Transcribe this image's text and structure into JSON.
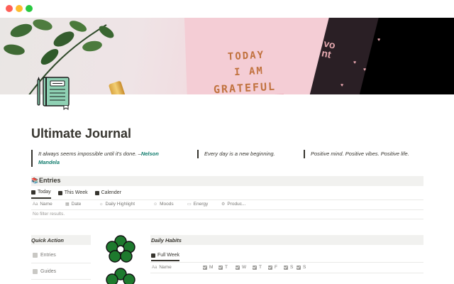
{
  "window": {
    "controls": [
      "close",
      "minimize",
      "maximize"
    ]
  },
  "cover": {
    "notebook_lines": [
      "TODAY",
      "I AM",
      "GRATEFUL"
    ],
    "corner_text": "vo\nnt"
  },
  "page": {
    "icon": "notebook-icon",
    "title": "Ultimate Journal"
  },
  "quotes": [
    {
      "text": "It always seems impossible until it's done. –",
      "author": "Nelson Mandela"
    },
    {
      "text": "Every day is a new beginning.",
      "author": ""
    },
    {
      "text": "Positive mind. Positive vibes. Positive life.",
      "author": ""
    }
  ],
  "entries": {
    "icon": "books-icon",
    "title": "Entries",
    "tabs": [
      {
        "label": "Today",
        "icon": "table-icon",
        "active": true
      },
      {
        "label": "This Week",
        "icon": "table-icon",
        "active": false
      },
      {
        "label": "Calender",
        "icon": "table-icon",
        "active": false
      }
    ],
    "properties": [
      {
        "label": "Name",
        "icon": "text-icon"
      },
      {
        "label": "Date",
        "icon": "calendar-icon"
      },
      {
        "label": "Daily Highlight",
        "icon": "sun-icon"
      },
      {
        "label": "Moods",
        "icon": "smiley-icon"
      },
      {
        "label": "Energy",
        "icon": "battery-icon"
      },
      {
        "label": "Produc...",
        "icon": "gear-icon"
      }
    ],
    "empty_text": "No filter results."
  },
  "quick_action": {
    "title": "Quick Action",
    "items": [
      {
        "label": "Entries",
        "icon": "books-icon"
      },
      {
        "label": "Guides",
        "icon": "map-icon"
      }
    ]
  },
  "daily_habits": {
    "title": "Daily Habits",
    "tab": {
      "label": "Full Week",
      "icon": "table-icon"
    },
    "columns": [
      {
        "label": "Name",
        "icon": "text-icon"
      },
      {
        "label": "M",
        "icon": "checkbox-icon"
      },
      {
        "label": "T",
        "icon": "checkbox-icon"
      },
      {
        "label": "W",
        "icon": "checkbox-icon"
      },
      {
        "label": "T",
        "icon": "checkbox-icon"
      },
      {
        "label": "F",
        "icon": "checkbox-icon"
      },
      {
        "label": "S",
        "icon": "checkbox-icon"
      },
      {
        "label": "S",
        "icon": "checkbox-icon"
      }
    ]
  },
  "colors": {
    "text": "#37352f",
    "muted": "#787774",
    "accent_green": "#0f7b6c",
    "flower_green": "#1e7a2e",
    "section_bg": "#f1f1ef"
  }
}
